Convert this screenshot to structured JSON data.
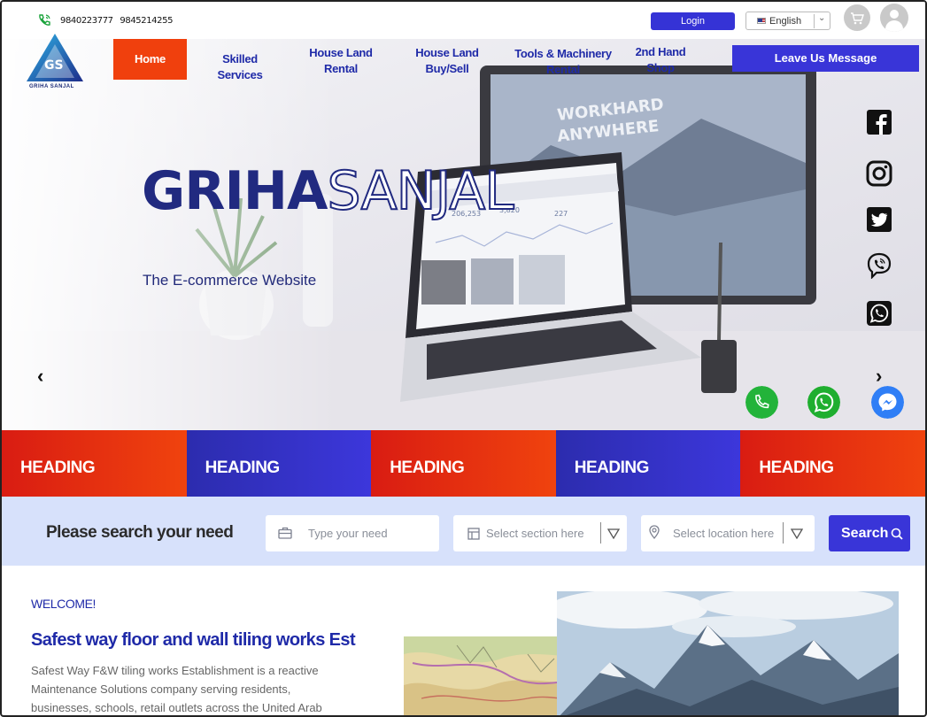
{
  "topbar": {
    "phone_1": "9840223777",
    "phone_2": "9845214255",
    "login_label": "Login",
    "language": "English"
  },
  "nav": {
    "logo_text": "GRIHA SANJAL",
    "items": [
      {
        "line1": "Home",
        "line2": ""
      },
      {
        "line1": "Skilled Services",
        "line2": ""
      },
      {
        "line1": "House Land",
        "line2": "Rental"
      },
      {
        "line1": "House Land",
        "line2": "Buy/Sell"
      },
      {
        "line1": "Tools & Machinery",
        "line2": "Rental"
      },
      {
        "line1": "2nd Hand",
        "line2": "Shop"
      }
    ],
    "leave_message_label": "Leave Us Message"
  },
  "hero": {
    "brand_bold": "GRIHA",
    "brand_light": "SANJAL",
    "tagline": "The E-commerce Website",
    "social": [
      "facebook-icon",
      "instagram-icon",
      "twitter-icon",
      "viber-icon",
      "whatsapp-icon"
    ],
    "contact_buttons": [
      "phone-icon",
      "whatsapp-icon",
      "messenger-icon"
    ],
    "laptop_screen_values": [
      "206,253",
      "3,820",
      "227"
    ],
    "monitor_text_1": "WORKHARD",
    "monitor_text_2": "ANYWHERE"
  },
  "strip": {
    "headings": [
      "HEADING",
      "HEADING",
      "HEADING",
      "HEADING",
      "HEADING"
    ]
  },
  "search": {
    "title": "Please search your need",
    "need_placeholder": "Type your need",
    "section_placeholder": "Select section here",
    "location_placeholder": "Select location here",
    "button_label": "Search"
  },
  "content": {
    "welcome": "WELCOME!",
    "title": "Safest way floor and wall tiling works Est",
    "body": "Safest Way F&W tiling works Establishment is a reactive Maintenance Solutions company serving residents, businesses, schools, retail outlets across the United Arab"
  },
  "colors": {
    "brand_blue": "#3935d8",
    "brand_red": "#f0400d",
    "search_bg": "#d7e1fb"
  }
}
